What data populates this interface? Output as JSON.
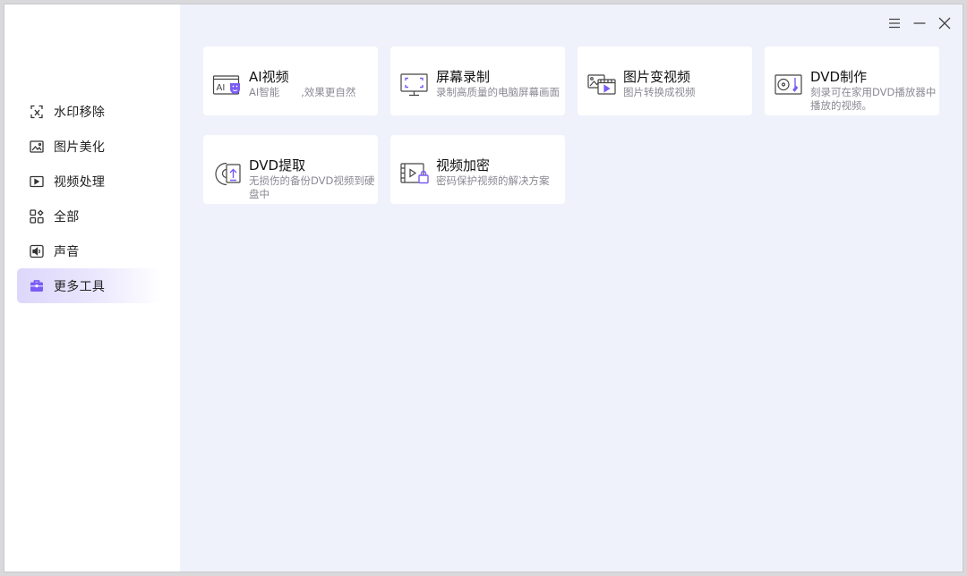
{
  "window_controls": {
    "menu_icon": "menu-icon",
    "minimize_icon": "minimize-icon",
    "close_icon": "close-icon"
  },
  "sidebar": {
    "items": [
      {
        "label": "水印移除",
        "icon": "watermark-remove-icon",
        "active": false
      },
      {
        "label": "图片美化",
        "icon": "image-enhance-icon",
        "active": false
      },
      {
        "label": "视频处理",
        "icon": "video-process-icon",
        "active": false
      },
      {
        "label": "全部",
        "icon": "all-apps-icon",
        "active": false
      },
      {
        "label": "声音",
        "icon": "audio-icon",
        "active": false
      },
      {
        "label": "更多工具",
        "icon": "toolbox-icon",
        "active": true
      }
    ]
  },
  "tools": [
    {
      "title": "AI视频",
      "desc_part1": "AI智能",
      "desc_part2": ",效果更自然",
      "icon": "ai-video-icon"
    },
    {
      "title": "屏幕录制",
      "desc": "录制高质量的电脑屏幕画面",
      "icon": "screen-record-icon"
    },
    {
      "title": "图片变视频",
      "desc": "图片转换成视频",
      "icon": "image-to-video-icon"
    },
    {
      "title": "DVD制作",
      "desc": "刻录可在家用DVD播放器中播放的视频。",
      "icon": "dvd-create-icon"
    },
    {
      "title": "DVD提取",
      "desc": "无损伤的备份DVD视频到硬盘中",
      "icon": "dvd-extract-icon"
    },
    {
      "title": "视频加密",
      "desc": "密码保护视频的解决方案",
      "icon": "video-encrypt-icon"
    }
  ],
  "colors": {
    "accent": "#7b5cf5",
    "active_bg": "#ddd7fb",
    "main_bg": "#eff2fb"
  }
}
